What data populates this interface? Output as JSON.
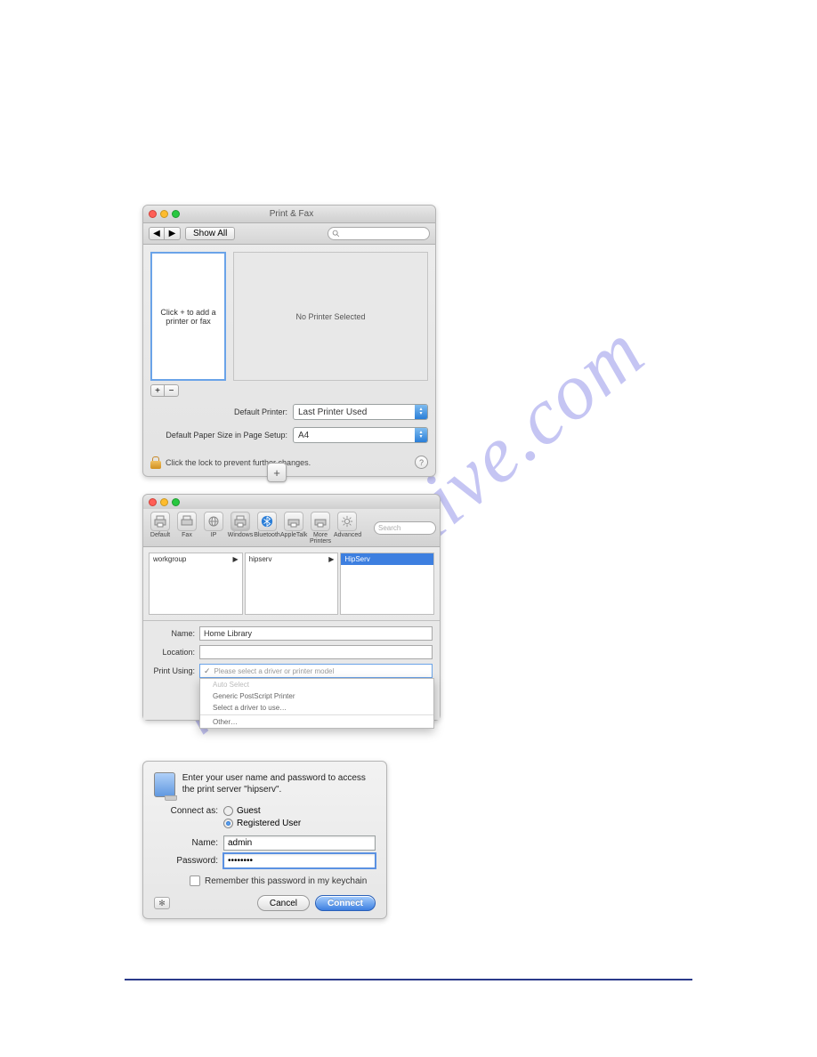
{
  "watermark": "manualshive.com",
  "win1": {
    "title": "Print & Fax",
    "back_glyph": "◀",
    "fwd_glyph": "▶",
    "show_all": "Show All",
    "list_placeholder": "Click + to add a printer or fax",
    "detail_placeholder": "No Printer Selected",
    "plus": "+",
    "minus": "−",
    "default_printer_label": "Default Printer:",
    "default_printer_value": "Last Printer Used",
    "paper_label": "Default Paper Size in Page Setup:",
    "paper_value": "A4",
    "lock_text": "Click the lock to prevent further changes.",
    "help": "?"
  },
  "plus_button": "+",
  "win2": {
    "tb": [
      {
        "label": "Default"
      },
      {
        "label": "Fax"
      },
      {
        "label": "IP"
      },
      {
        "label": "Windows"
      },
      {
        "label": "Bluetooth"
      },
      {
        "label": "AppleTalk"
      },
      {
        "label": "More Printers"
      },
      {
        "label": "Advanced"
      }
    ],
    "search_placeholder": "Search",
    "col1": "workgroup",
    "col2": "hipserv",
    "col3": "HipServ",
    "form": {
      "name_label": "Name:",
      "name_value": "Home Library",
      "location_label": "Location:",
      "location_value": "",
      "pu_label": "Print Using:",
      "pu_value": "Please select a driver or printer model"
    },
    "menu": {
      "auto": "Auto Select",
      "generic": "Generic PostScript Printer",
      "selectdrv": "Select a driver to use…",
      "other": "Other…"
    }
  },
  "win3": {
    "prompt": "Enter your user name and password to access the print server \"hipserv\".",
    "connect_as_label": "Connect as:",
    "guest": "Guest",
    "registered": "Registered User",
    "name_label": "Name:",
    "name_value": "admin",
    "password_label": "Password:",
    "password_value": "••••••••",
    "remember": "Remember this password in my keychain",
    "cancel": "Cancel",
    "connect": "Connect",
    "gear": "✻"
  }
}
